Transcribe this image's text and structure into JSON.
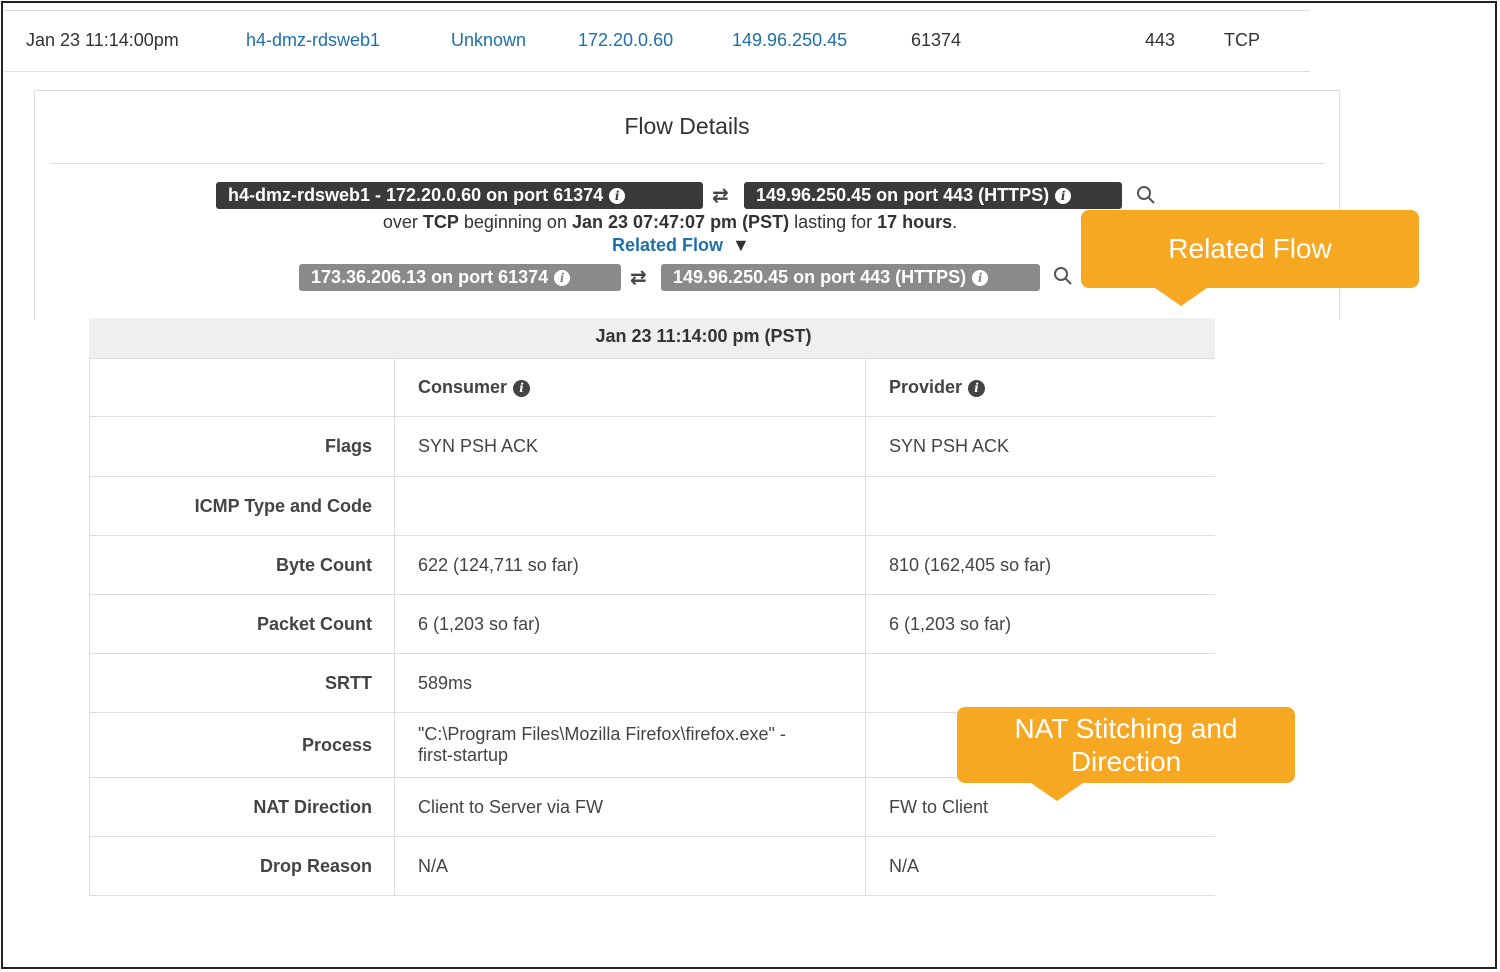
{
  "top_row": {
    "time": "Jan 23 11:14:00pm",
    "host": "h4-dmz-rdsweb1",
    "scope": "Unknown",
    "src_ip": "172.20.0.60",
    "dst_ip": "149.96.250.45",
    "src_port": "61374",
    "dst_port": "443",
    "protocol": "TCP"
  },
  "flow_details": {
    "title": "Flow Details",
    "consumer_pill": "h4-dmz-rdsweb1 - 172.20.0.60 on port 61374",
    "provider_pill": "149.96.250.45 on port 443 (HTTPS)",
    "swap_glyph": "⇄",
    "info_glyph": "i",
    "summary": {
      "over": "over ",
      "proto": "TCP",
      "beginning": " beginning on ",
      "start": "Jan 23 07:47:07 pm (PST)",
      "lasting": " lasting for ",
      "duration": "17 hours",
      "end": "."
    },
    "related_label": "Related Flow",
    "related_caret": "▼",
    "related_consumer_pill": "173.36.206.13 on port 61374",
    "related_provider_pill": "149.96.250.45 on port 443 (HTTPS)"
  },
  "table": {
    "timestamp": "Jan 23 11:14:00 pm (PST)",
    "consumer_header": "Consumer",
    "provider_header": "Provider",
    "rows": [
      {
        "label": "Flags",
        "consumer": "SYN PSH ACK",
        "provider": "SYN PSH ACK"
      },
      {
        "label": "ICMP Type and Code",
        "consumer": "",
        "provider": ""
      },
      {
        "label": "Byte Count",
        "consumer": "622 (124,711 so far)",
        "provider": "810 (162,405 so far)"
      },
      {
        "label": "Packet Count",
        "consumer": "6 (1,203 so far)",
        "provider": "6 (1,203 so far)"
      },
      {
        "label": "SRTT",
        "consumer": "589ms",
        "provider": ""
      },
      {
        "label": "Process",
        "consumer_line1": "\"C:\\Program Files\\Mozilla Firefox\\firefox.exe\" -",
        "consumer_line2": "first-startup",
        "provider": ""
      },
      {
        "label": "NAT Direction",
        "consumer": "Client to Server via FW",
        "provider": "FW to Client"
      },
      {
        "label": "Drop Reason",
        "consumer": "N/A",
        "provider": "N/A"
      }
    ]
  },
  "callouts": {
    "related": "Related Flow",
    "nat_line1": "NAT Stitching and",
    "nat_line2": "Direction"
  },
  "colors": {
    "link": "#1f6fa8",
    "pill_dark": "#3a3a3a",
    "pill_grey": "#8a8a8a",
    "callout": "#f7a823"
  },
  "icons": {
    "search": "search-icon",
    "info": "info-icon",
    "swap": "swap-arrows-icon",
    "caret": "caret-down-icon"
  }
}
